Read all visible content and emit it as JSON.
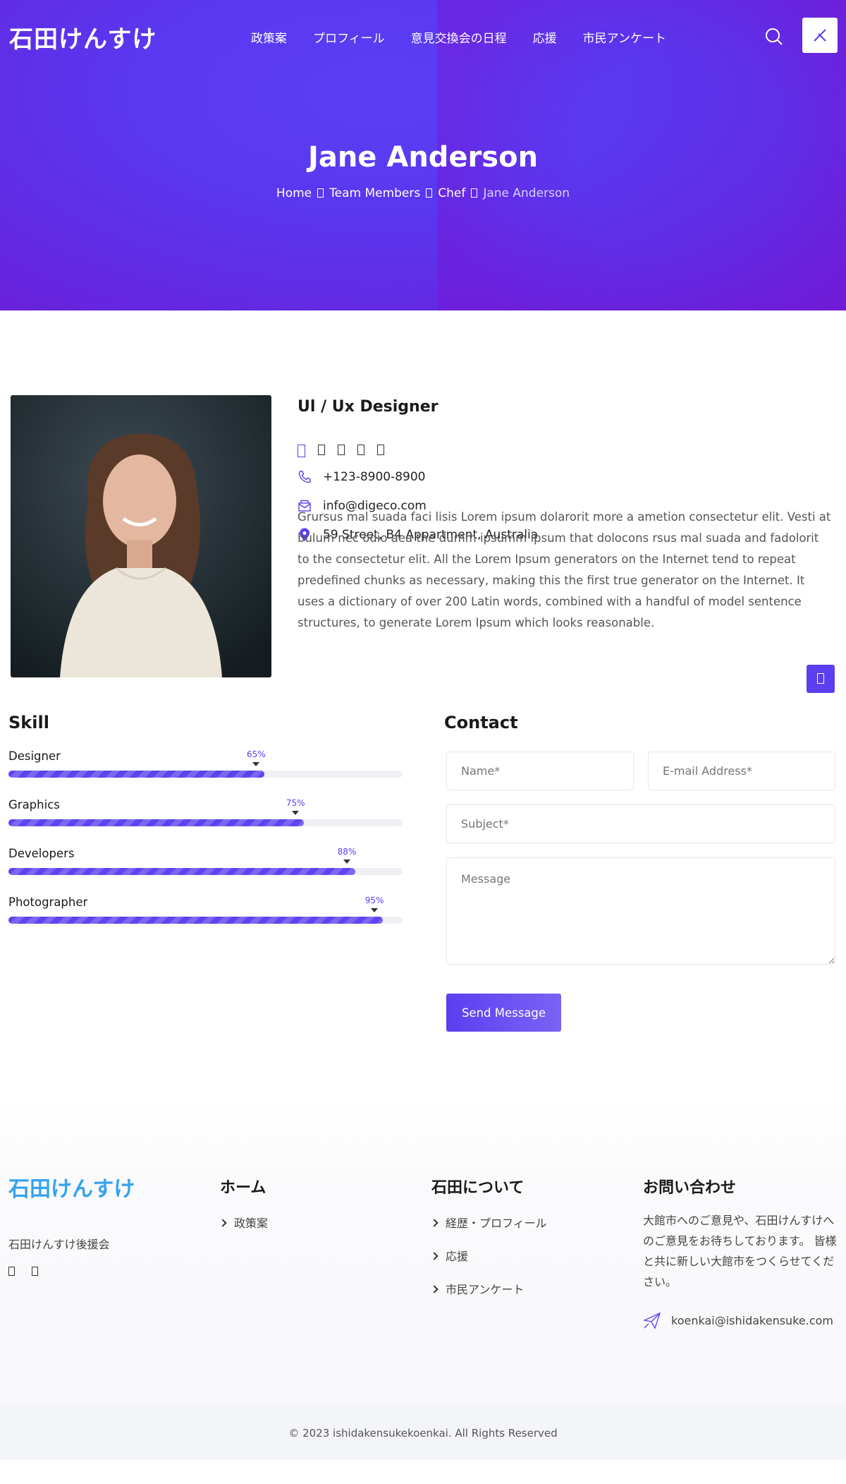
{
  "header": {
    "logo": "石田けんすけ",
    "nav": [
      "政策案",
      "プロフィール",
      "意見交換会の日程",
      "応援",
      "市民アンケート"
    ]
  },
  "hero": {
    "title": "Jane Anderson",
    "breadcrumb": [
      "Home",
      "Team Members",
      "Chef",
      "Jane Anderson"
    ]
  },
  "profile": {
    "role": "Ul / Ux Designer",
    "phone": "+123-8900-8900",
    "email": "info@digeco.com",
    "address": "59 Street, B4 Appartment, Australia",
    "description": "Grursus mal suada faci lisis Lorem ipsum dolarorit more a ametion consectetur elit. Vesti at bulum nec odio aea the dumm ipsumm ipsum that dolocons rsus mal suada and fadolorit to the consectetur elit. All the Lorem Ipsum generators on the Internet tend to repeat predefined chunks as necessary, making this the first true generator on the Internet. It uses a dictionary of over 200 Latin words, combined with a handful of model sentence structures, to generate Lorem Ipsum which looks reasonable."
  },
  "skills": {
    "title": "Skill",
    "items": [
      {
        "name": "Designer",
        "percent": 65,
        "label": "65%"
      },
      {
        "name": "Graphics",
        "percent": 75,
        "label": "75%"
      },
      {
        "name": "Developers",
        "percent": 88,
        "label": "88%"
      },
      {
        "name": "Photographer",
        "percent": 95,
        "label": "95%"
      }
    ]
  },
  "contact": {
    "title": "Contact",
    "name_placeholder": "Name*",
    "email_placeholder": "E-mail Address*",
    "subject_placeholder": "Subject*",
    "message_placeholder": "Message",
    "send_label": "Send Message"
  },
  "footer": {
    "logo": "石田けんすけ",
    "org": "石田けんすけ後援会",
    "col2": {
      "title": "ホーム",
      "links": [
        "政策案"
      ]
    },
    "col3": {
      "title": "石田について",
      "links": [
        "経歴・プロフィール",
        "応援",
        "市民アンケート"
      ]
    },
    "col4": {
      "title": "お問い合わせ",
      "text": "大館市へのご意見や、石田けんすけへのご意見をお待ちしております。 皆様と共に新しい大館市をつくらせてください。",
      "email": "koenkai@ishidakensuke.com"
    },
    "copyright": "© 2023 ishidakensukekoenkai. All Rights Reserved"
  },
  "colors": {
    "accent": "#5b3ff0",
    "hero_start": "#5b3ff5",
    "hero_end": "#6a1fd8",
    "footer_logo": "#34a3ee"
  },
  "icons": [
    "search-icon",
    "close-icon",
    "phone-icon",
    "mail-icon",
    "location-icon",
    "send-paper-plane-icon"
  ]
}
